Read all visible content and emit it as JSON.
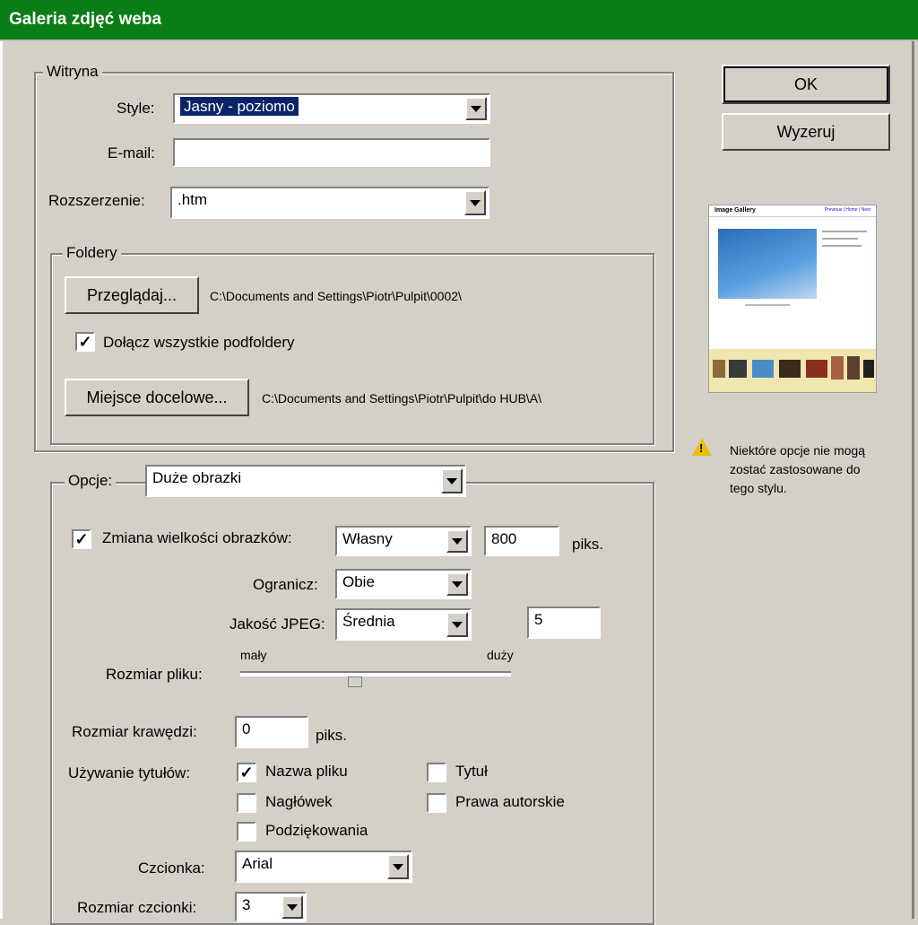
{
  "window": {
    "title": "Galeria zdjęć weba"
  },
  "buttons": {
    "ok": "OK",
    "cancel": "Wyzeruj"
  },
  "display_group": {
    "legend": "Witryna",
    "style_label": "Style:",
    "style_value": "Jasny - poziomo",
    "email_label": "E-mail:",
    "email_value": "",
    "extension_label": "Rozszerzenie:",
    "extension_value": ".htm"
  },
  "folders_group": {
    "legend": "Foldery",
    "browse_button": "Przeglądaj...",
    "source_path": "C:\\Documents and Settings\\Piotr\\Pulpit\\0002\\",
    "include_subfolders_label": "Dołącz wszystkie podfoldery",
    "include_subfolders_checked": true,
    "destination_button": "Miejsce docelowe...",
    "destination_path": "C:\\Documents and Settings\\Piotr\\Pulpit\\do HUB\\A\\"
  },
  "options_group": {
    "legend": "Opcje:",
    "options_value": "Duże obrazki",
    "resize_label": "Zmiana wielkości obrazków:",
    "resize_checked": true,
    "resize_mode": "Własny",
    "resize_value": "800",
    "resize_unit": "piks.",
    "constrain_label": "Ogranicz:",
    "constrain_value": "Obie",
    "jpeg_label": "Jakość JPEG:",
    "jpeg_value": "Średnia",
    "jpeg_number": "5",
    "filesize_label": "Rozmiar pliku:",
    "slider_min": "mały",
    "slider_max": "duży",
    "slider_fraction": 0.42,
    "border_label": "Rozmiar krawędzi:",
    "border_value": "0",
    "border_unit": "piks.",
    "titles_label": "Używanie tytułów:",
    "title_options": [
      {
        "label": "Nazwa pliku",
        "checked": true
      },
      {
        "label": "Tytuł",
        "checked": false
      },
      {
        "label": "Nagłówek",
        "checked": false
      },
      {
        "label": "Prawa autorskie",
        "checked": false
      },
      {
        "label": "Podziękowania",
        "checked": false
      }
    ],
    "font_label": "Czcionka:",
    "font_value": "Arial",
    "font_size_label": "Rozmiar czcionki:",
    "font_size_value": "3"
  },
  "preview": {
    "heading": "Image Gallery",
    "nav": "Previous | Home | Next"
  },
  "warning": {
    "text": "Niektóre opcje nie mogą zostać zastosowane do tego stylu."
  },
  "colors": {
    "titlebar": "#0a7d17",
    "dialog": "#d4d0c8",
    "selection": "#0a246a"
  }
}
